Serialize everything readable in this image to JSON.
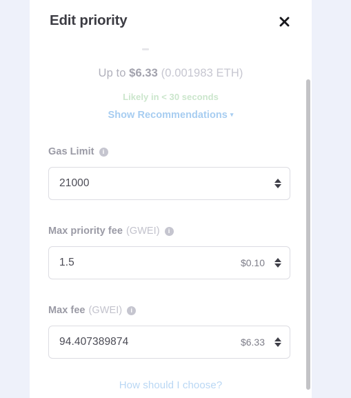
{
  "colors": {
    "page_background": "#eef1fa",
    "panel_background": "#ffffff",
    "title_text": "#3c3c43",
    "estimate_text": "#b0b0bb",
    "speed_green": "#cbe6cc",
    "link_blue": "#a7cdf1",
    "help_link_blue": "#b9d7f4",
    "input_border": "#dcdce2",
    "scrollbar_thumb": "#c3c3c6"
  },
  "header": {
    "title": "Edit priority",
    "close_label": "✕"
  },
  "estimate": {
    "prefix": "Up to ",
    "amount": "$6.33",
    "native": " (0.001983 ETH)",
    "speed": "Likely in < 30 seconds",
    "recommendations_label": "Show Recommendations",
    "recommendations_caret": "▾"
  },
  "fields": [
    {
      "id": "gas-limit",
      "label": "Gas Limit",
      "unit": "",
      "info": "i",
      "value": "21000",
      "fiat": ""
    },
    {
      "id": "max-priority-fee",
      "label": "Max priority fee",
      "unit": "(GWEI)",
      "info": "i",
      "value": "1.5",
      "fiat": "$0.10"
    },
    {
      "id": "max-fee",
      "label": "Max fee",
      "unit": "(GWEI)",
      "info": "i",
      "value": "94.407389874",
      "fiat": "$6.33"
    }
  ],
  "footer": {
    "help_link": "How should I choose?"
  }
}
